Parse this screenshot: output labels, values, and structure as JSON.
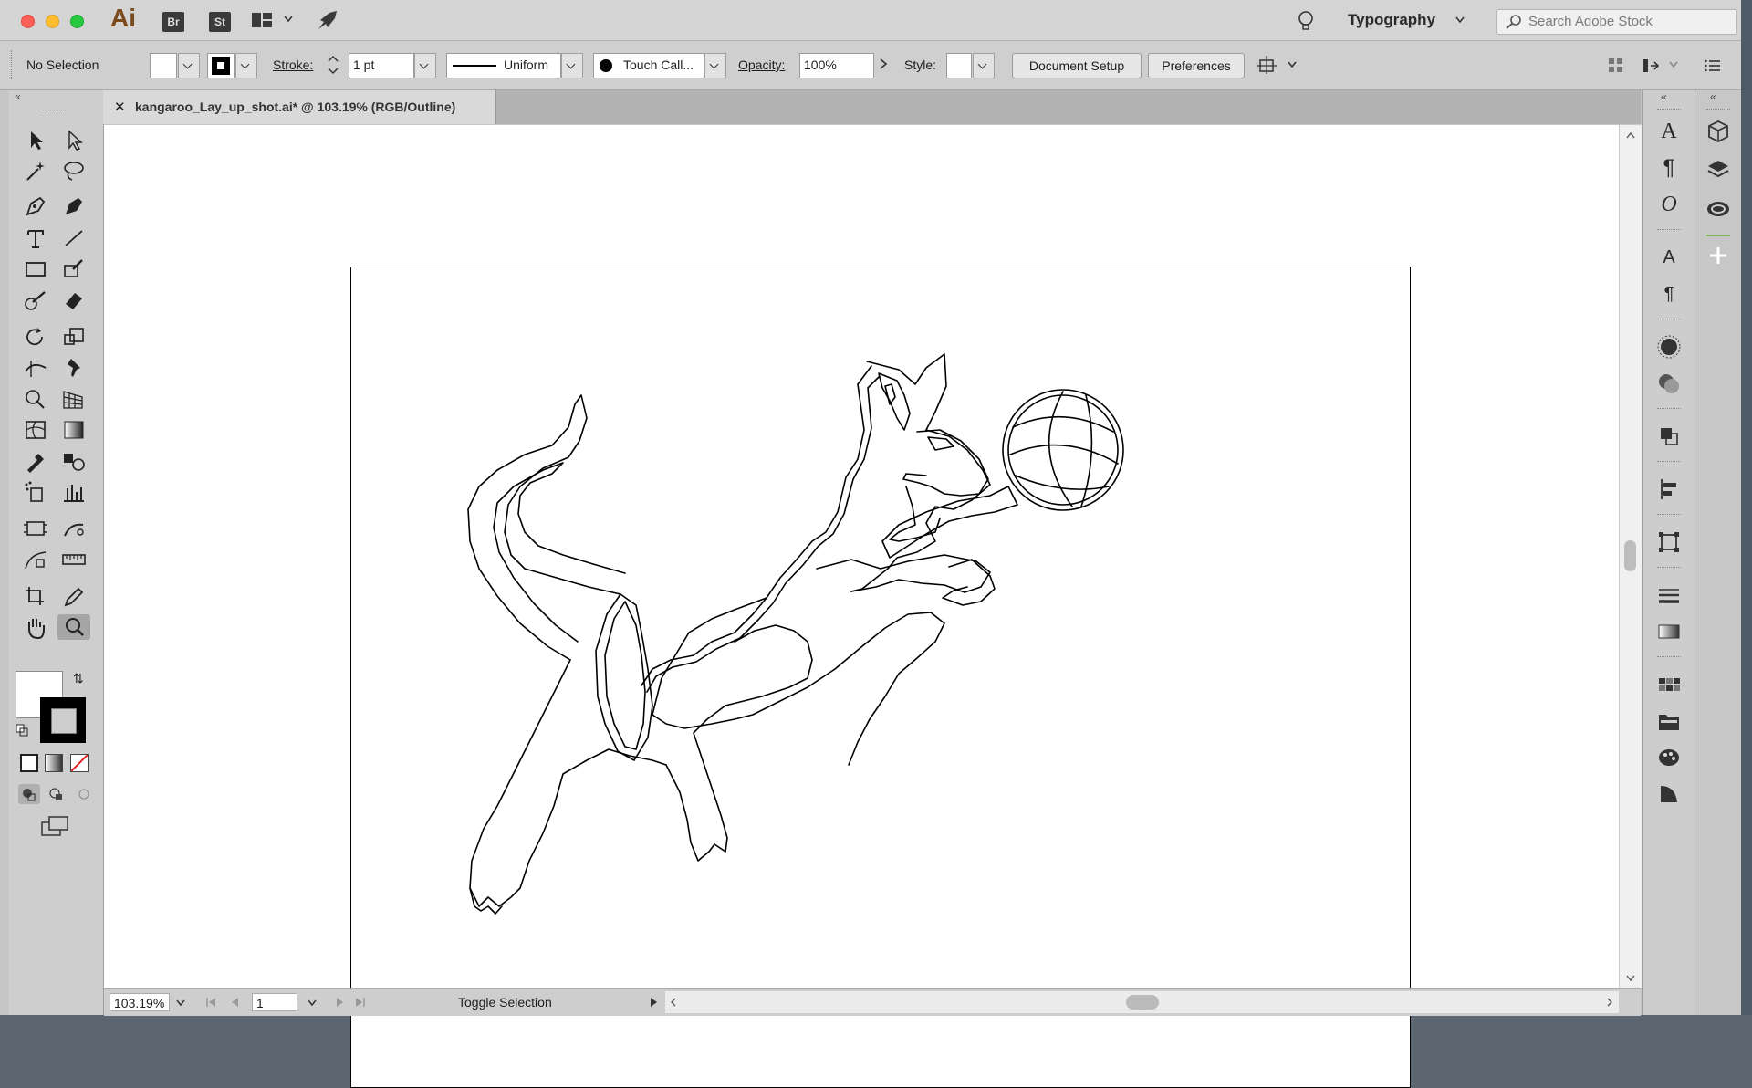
{
  "appbar": {
    "logo": "Ai",
    "bridge": "Br",
    "stock": "St",
    "workspace": "Typography",
    "search_placeholder": "Search Adobe Stock"
  },
  "control": {
    "selection": "No Selection",
    "stroke_label": "Stroke:",
    "stroke_value": "1 pt",
    "profile": "Uniform",
    "brush": "Touch Call...",
    "opacity_label": "Opacity:",
    "opacity_value": "100%",
    "style_label": "Style:",
    "doc_setup": "Document Setup",
    "preferences": "Preferences"
  },
  "document": {
    "tab_title": "kangaroo_Lay_up_shot.ai* @ 103.19% (RGB/Outline)"
  },
  "status": {
    "zoom": "103.19%",
    "page": "1",
    "label": "Toggle Selection"
  },
  "colors": {
    "logo": "#7a4a1c",
    "panel": "#cecece",
    "canvas": "#ffffff"
  }
}
